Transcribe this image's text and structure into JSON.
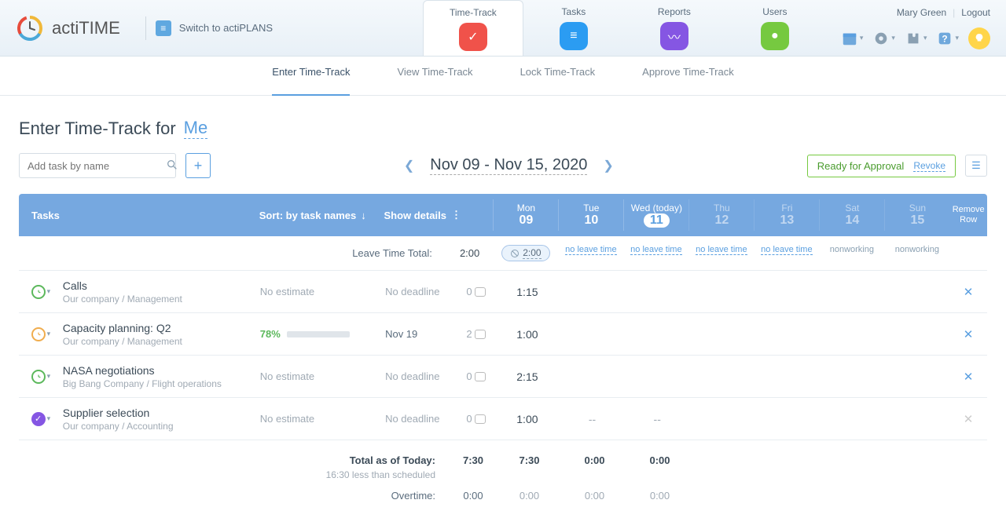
{
  "app": {
    "name": "actiTIME",
    "switch": "Switch to actiPLANS"
  },
  "user": {
    "name": "Mary Green",
    "logout": "Logout"
  },
  "nav": [
    {
      "label": "Time-Track",
      "color": "red"
    },
    {
      "label": "Tasks",
      "color": "blue"
    },
    {
      "label": "Reports",
      "color": "purple"
    },
    {
      "label": "Users",
      "color": "green"
    }
  ],
  "subnav": [
    {
      "label": "Enter Time-Track",
      "active": true
    },
    {
      "label": "View Time-Track"
    },
    {
      "label": "Lock Time-Track"
    },
    {
      "label": "Approve Time-Track"
    }
  ],
  "page": {
    "title": "Enter Time-Track for",
    "who": "Me"
  },
  "search": {
    "placeholder": "Add task by name"
  },
  "dateRange": "Nov 09 - Nov 15, 2020",
  "approval": {
    "ready": "Ready for Approval",
    "revoke": "Revoke"
  },
  "columns": {
    "tasks": "Tasks",
    "sort": "Sort: by task names",
    "details": "Show details",
    "remove": "Remove Row"
  },
  "days": [
    {
      "short": "Mon",
      "num": "09"
    },
    {
      "short": "Tue",
      "num": "10"
    },
    {
      "short": "Wed (today)",
      "num": "11",
      "today": true
    },
    {
      "short": "Thu",
      "num": "12",
      "faded": true
    },
    {
      "short": "Fri",
      "num": "13",
      "faded": true
    },
    {
      "short": "Sat",
      "num": "14",
      "faded": true
    },
    {
      "short": "Sun",
      "num": "15",
      "faded": true
    }
  ],
  "leave": {
    "label": "Leave Time Total:",
    "total": "2:00",
    "cells": [
      "",
      "no leave time",
      "no leave time",
      "no leave time",
      "no leave time",
      "nonworking",
      "nonworking"
    ],
    "monPill": "2:00"
  },
  "tasks": [
    {
      "status": "green",
      "name": "Calls",
      "path": "Our company / Management",
      "estimate": "No estimate",
      "deadline": "No deadline",
      "comments": "0",
      "times": [
        "1:15",
        "",
        "",
        "",
        "",
        "",
        ""
      ],
      "removable": true
    },
    {
      "status": "orange",
      "name": "Capacity planning: Q2",
      "path": "Our company / Management",
      "estimatePct": "78%",
      "progress": 78,
      "deadline": "Nov 19",
      "hasDeadline": true,
      "comments": "2",
      "times": [
        "1:00",
        "",
        "",
        "",
        "",
        "",
        ""
      ],
      "removable": true
    },
    {
      "status": "green",
      "name": "NASA negotiations",
      "path": "Big Bang Company / Flight operations",
      "estimate": "No estimate",
      "deadline": "No deadline",
      "comments": "0",
      "times": [
        "2:15",
        "",
        "",
        "",
        "",
        "",
        ""
      ],
      "removable": true
    },
    {
      "status": "purple",
      "name": "Supplier selection",
      "path": "Our company / Accounting",
      "estimate": "No estimate",
      "deadline": "No deadline",
      "comments": "0",
      "times": [
        "1:00",
        "--",
        "--",
        "",
        "",
        "",
        ""
      ],
      "removable": false
    }
  ],
  "totals": {
    "label": "Total as of Today:",
    "grand": "7:30",
    "note": "16:30 less than scheduled",
    "days": [
      "7:30",
      "0:00",
      "0:00",
      "",
      "",
      "",
      ""
    ]
  },
  "overtime": {
    "label": "Overtime:",
    "grand": "0:00",
    "days": [
      "0:00",
      "0:00",
      "0:00",
      "",
      "",
      "",
      ""
    ]
  }
}
